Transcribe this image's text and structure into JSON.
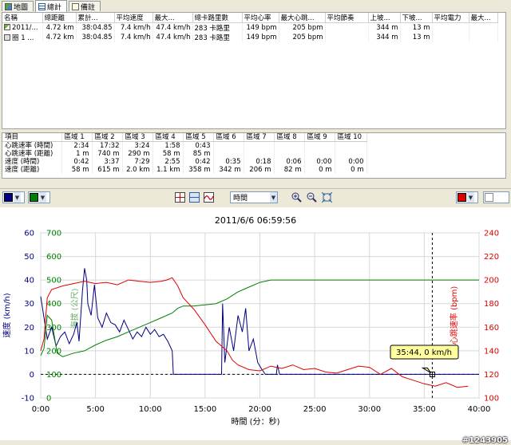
{
  "tabs": [
    {
      "label": "地圖",
      "icon": "map-icon",
      "active": false
    },
    {
      "label": "總計",
      "icon": "table-icon",
      "active": true
    },
    {
      "label": "備註",
      "icon": "note-icon",
      "active": false
    }
  ],
  "summary": {
    "headers": [
      "名稱",
      "總距離",
      "累計...",
      "平均速度",
      "最大...",
      "總卡路里數",
      "平均心率",
      "最大心跳...",
      "平均節奏",
      "上坡...",
      "下坡...",
      "平均電力",
      "最大..."
    ],
    "rows": [
      [
        "2011/...",
        "4.72 km",
        "38:04.85",
        "7.4 km/h",
        "47.4 km/h",
        "283 卡路里",
        "149 bpm",
        "205 bpm",
        "",
        "344 m",
        "13 m",
        "",
        ""
      ],
      [
        "圈 1 ...",
        "4.72 km",
        "38:04.85",
        "7.4 km/h",
        "47.4 km/h",
        "283 卡路里",
        "149 bpm",
        "205 bpm",
        "",
        "344 m",
        "13 m",
        "",
        ""
      ]
    ]
  },
  "zones": {
    "headers": [
      "項目",
      "區域 1",
      "區域 2",
      "區域 3",
      "區域 4",
      "區域 5",
      "區域 6",
      "區域 7",
      "區域 8",
      "區域 9",
      "區域 10"
    ],
    "rows": [
      [
        "心跳速率 (時間)",
        "2:34",
        "17:32",
        "3:24",
        "1:58",
        "0:43",
        "",
        "",
        "",
        "",
        ""
      ],
      [
        "心跳速率 (距離)",
        "1 m",
        "740 m",
        "290 m",
        "58 m",
        "85 m",
        "",
        "",
        "",
        "",
        ""
      ],
      [
        "速度 (時間)",
        "0:42",
        "3:37",
        "7:29",
        "2:55",
        "0:42",
        "0:35",
        "0:18",
        "0:06",
        "0:00",
        "0:00"
      ],
      [
        "速度 (距離)",
        "58 m",
        "615 m",
        "2.0 km",
        "1.1 km",
        "358 m",
        "342 m",
        "206 m",
        "82 m",
        "0 m",
        "0 m"
      ]
    ]
  },
  "toolbar": {
    "left_color1": "#000080",
    "left_color2": "#008000",
    "x_axis_select": "時間",
    "right_color": "#e00000",
    "icons": [
      "chart-layout-icon",
      "split-view-icon",
      "line-icon",
      "zoom-in-icon",
      "zoom-out-icon",
      "fit-icon"
    ]
  },
  "chart_data": {
    "type": "line",
    "title": "2011/6/6 06:59:56",
    "xlabel": "時間 (分：秒)",
    "x_ticks": [
      "0:00",
      "5:00",
      "10:00",
      "15:00",
      "20:00",
      "25:00",
      "30:00",
      "35:00",
      "40:00"
    ],
    "xlim_minutes": [
      0,
      40
    ],
    "y_left_speed": {
      "label": "速度 (km/h)",
      "ticks": [
        "60",
        "50",
        "40",
        "30",
        "20",
        "10",
        "0",
        "-10"
      ],
      "range": [
        -10,
        60
      ],
      "color": "#000080"
    },
    "y_left_elevation": {
      "label": "海拔 (公尺)",
      "ticks": [
        "700",
        "600",
        "500",
        "400",
        "300",
        "200",
        "100",
        "0"
      ],
      "range": [
        0,
        700
      ],
      "color": "#008000"
    },
    "y_right_hr": {
      "label": "心跳速率 (bpm)",
      "ticks": [
        "240",
        "220",
        "200",
        "180",
        "160",
        "140",
        "120",
        "100"
      ],
      "range": [
        100,
        240
      ],
      "color": "#e00000"
    },
    "grid": true,
    "cursor": {
      "x_minutes": 35.73,
      "label": "35:44, 0 km/h"
    },
    "series": [
      {
        "name": "速度",
        "axis": "speed",
        "color": "#000080",
        "points": [
          [
            0,
            33
          ],
          [
            0.3,
            24
          ],
          [
            0.6,
            15
          ],
          [
            1,
            20
          ],
          [
            1.4,
            12
          ],
          [
            1.8,
            16
          ],
          [
            2.2,
            18
          ],
          [
            2.6,
            13
          ],
          [
            3,
            17
          ],
          [
            3.3,
            22
          ],
          [
            3.5,
            14
          ],
          [
            3.8,
            35
          ],
          [
            4,
            45
          ],
          [
            4.2,
            40
          ],
          [
            4.3,
            30
          ],
          [
            4.6,
            25
          ],
          [
            4.9,
            38
          ],
          [
            5.2,
            24
          ],
          [
            5.6,
            20
          ],
          [
            6,
            26
          ],
          [
            6.4,
            22
          ],
          [
            6.8,
            21
          ],
          [
            7.2,
            18
          ],
          [
            7.6,
            23
          ],
          [
            8,
            19
          ],
          [
            8.4,
            15
          ],
          [
            8.8,
            18
          ],
          [
            9.2,
            16
          ],
          [
            9.6,
            20
          ],
          [
            10,
            17
          ],
          [
            10.4,
            19
          ],
          [
            10.8,
            16
          ],
          [
            11.2,
            17
          ],
          [
            11.6,
            14
          ],
          [
            12,
            10
          ],
          [
            12.1,
            0
          ],
          [
            16.5,
            0
          ],
          [
            16.6,
            30
          ],
          [
            16.8,
            5
          ],
          [
            17.2,
            20
          ],
          [
            17.6,
            10
          ],
          [
            18,
            25
          ],
          [
            18.4,
            18
          ],
          [
            18.7,
            28
          ],
          [
            19,
            10
          ],
          [
            19.4,
            15
          ],
          [
            19.8,
            5
          ],
          [
            20.2,
            2
          ],
          [
            20.5,
            0
          ],
          [
            21.5,
            0
          ],
          [
            21.6,
            4
          ],
          [
            21.8,
            0
          ],
          [
            40,
            0
          ]
        ]
      },
      {
        "name": "海拔",
        "axis": "elevation",
        "color": "#008000",
        "points": [
          [
            0,
            180
          ],
          [
            0.3,
            210
          ],
          [
            0.6,
            350
          ],
          [
            1,
            330
          ],
          [
            1.5,
            190
          ],
          [
            2,
            175
          ],
          [
            3,
            190
          ],
          [
            4,
            200
          ],
          [
            5,
            225
          ],
          [
            6,
            245
          ],
          [
            7,
            260
          ],
          [
            8,
            280
          ],
          [
            9,
            300
          ],
          [
            10,
            320
          ],
          [
            11,
            340
          ],
          [
            12,
            360
          ],
          [
            12.5,
            380
          ],
          [
            13,
            390
          ],
          [
            14,
            390
          ],
          [
            15,
            395
          ],
          [
            16,
            400
          ],
          [
            17,
            420
          ],
          [
            18,
            450
          ],
          [
            19,
            470
          ],
          [
            20,
            490
          ],
          [
            21,
            500
          ],
          [
            22,
            500
          ],
          [
            25,
            500
          ],
          [
            30,
            500
          ],
          [
            35,
            500
          ],
          [
            40,
            500
          ]
        ]
      },
      {
        "name": "心跳速率",
        "axis": "hr",
        "color": "#e00000",
        "points": [
          [
            0,
            140
          ],
          [
            0.3,
            150
          ],
          [
            0.6,
            185
          ],
          [
            1,
            192
          ],
          [
            2,
            195
          ],
          [
            3,
            197
          ],
          [
            4,
            199
          ],
          [
            5,
            197
          ],
          [
            6,
            198
          ],
          [
            7,
            196
          ],
          [
            8,
            200
          ],
          [
            9,
            199
          ],
          [
            10,
            198
          ],
          [
            11,
            199
          ],
          [
            11.5,
            200
          ],
          [
            12,
            202
          ],
          [
            12.5,
            195
          ],
          [
            13,
            185
          ],
          [
            14,
            175
          ],
          [
            15,
            162
          ],
          [
            16,
            148
          ],
          [
            17,
            140
          ],
          [
            17.5,
            132
          ],
          [
            18,
            128
          ],
          [
            19,
            124
          ],
          [
            20,
            123
          ],
          [
            21,
            127
          ],
          [
            22,
            125
          ],
          [
            23,
            128
          ],
          [
            24,
            124
          ],
          [
            25,
            125
          ],
          [
            26,
            122
          ],
          [
            27,
            121
          ],
          [
            28,
            124
          ],
          [
            29,
            127
          ],
          [
            30,
            126
          ],
          [
            31,
            120
          ],
          [
            32,
            125
          ],
          [
            33,
            118
          ],
          [
            34,
            115
          ],
          [
            35,
            112
          ],
          [
            36,
            110
          ],
          [
            37,
            113
          ],
          [
            38,
            109
          ],
          [
            39,
            110
          ]
        ]
      }
    ]
  },
  "watermark": "#1243905"
}
